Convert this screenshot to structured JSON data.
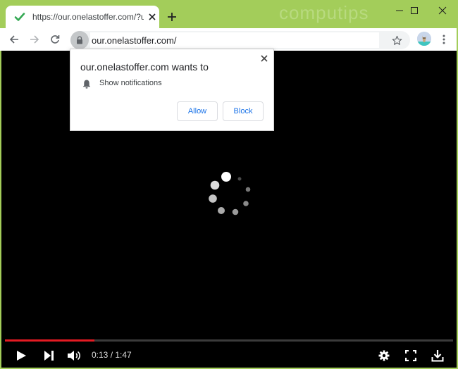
{
  "browser": {
    "tab": {
      "title": "https://our.onelastoffer.com/?utm",
      "favicon": "checkmark-icon",
      "favicon_color": "#34a853"
    },
    "watermark": "computips",
    "window_controls": [
      "minimize-icon",
      "maximize-icon",
      "close-icon"
    ],
    "theme_color": "#a3cd5a"
  },
  "toolbar": {
    "back_icon": "arrow-left-icon",
    "forward_icon": "arrow-right-icon",
    "reload_icon": "reload-icon",
    "url": "our.onelastoffer.com/",
    "security_icon": "lock-icon",
    "bookmark_icon": "star-icon",
    "profile_icon": "avatar",
    "menu_icon": "more-vert-icon"
  },
  "permission_popup": {
    "title": "our.onelastoffer.com wants to",
    "permission_icon": "bell-icon",
    "permission": "Show notifications",
    "allow_label": "Allow",
    "block_label": "Block",
    "button_text_color": "#1a73e8"
  },
  "video": {
    "loading": true,
    "progress_fraction": 0.2,
    "progress_color": "#e41b23",
    "time_current": "0:13",
    "time_separator": " / ",
    "time_total": "1:47",
    "time_display": "0:13 / 1:47",
    "controls_left": [
      "play-icon",
      "next-icon",
      "volume-icon"
    ],
    "controls_right": [
      "settings-icon",
      "fullscreen-icon",
      "download-icon"
    ]
  }
}
